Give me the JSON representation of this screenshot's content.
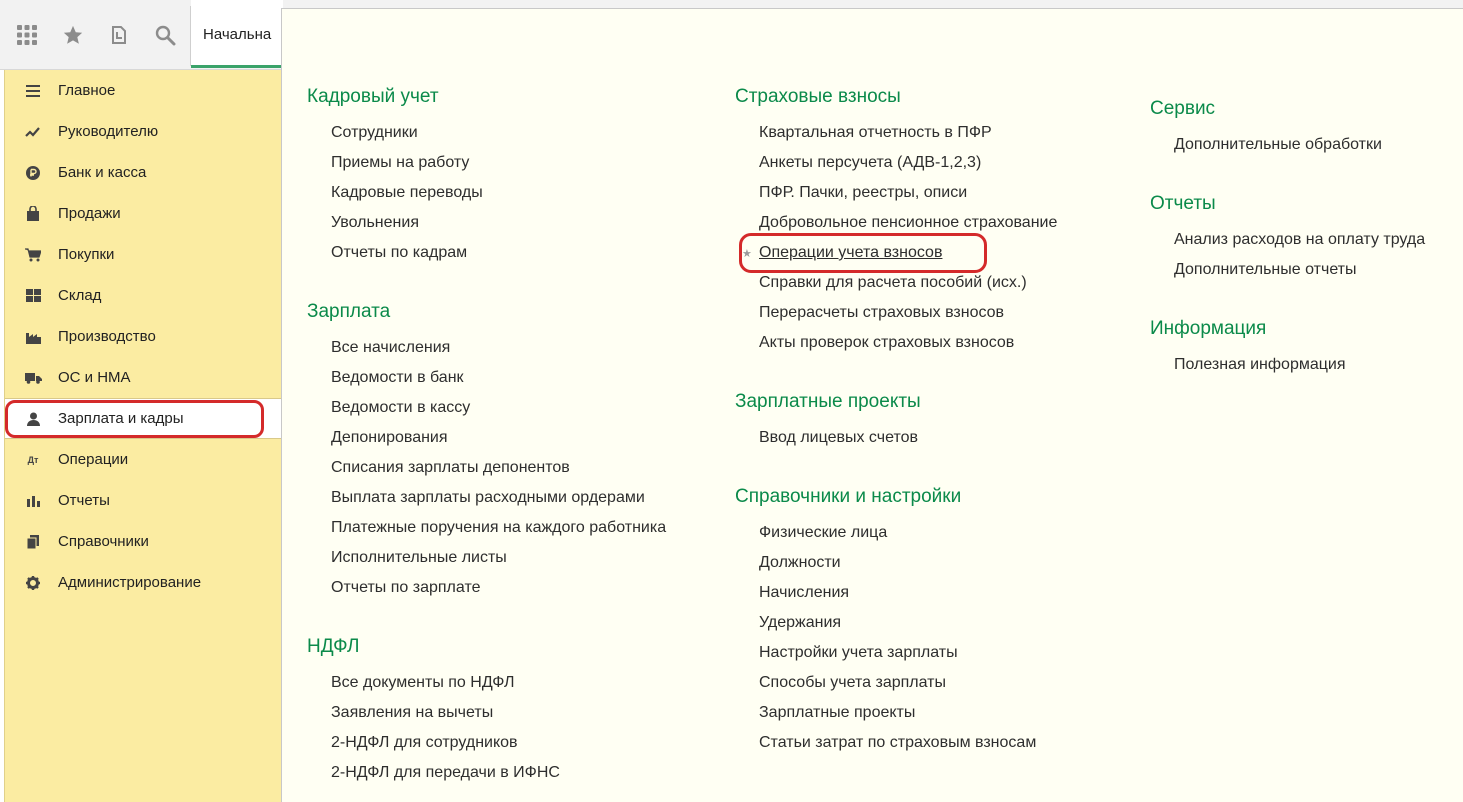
{
  "toolbar": {
    "icons": [
      "apps-grid-icon",
      "star-icon",
      "history-icon",
      "search-icon"
    ],
    "tab_label": "Начальна"
  },
  "sidebar": {
    "items": [
      {
        "label": "Главное",
        "icon": "menu-lines-icon"
      },
      {
        "label": "Руководителю",
        "icon": "trend-icon"
      },
      {
        "label": "Банк и касса",
        "icon": "ruble-coin-icon"
      },
      {
        "label": "Продажи",
        "icon": "shopping-bag-icon"
      },
      {
        "label": "Покупки",
        "icon": "cart-icon"
      },
      {
        "label": "Склад",
        "icon": "warehouse-icon"
      },
      {
        "label": "Производство",
        "icon": "factory-icon"
      },
      {
        "label": "ОС и НМА",
        "icon": "truck-icon"
      },
      {
        "label": "Зарплата и кадры",
        "icon": "person-icon"
      },
      {
        "label": "Операции",
        "icon": "debit-credit-icon"
      },
      {
        "label": "Отчеты",
        "icon": "bar-chart-icon"
      },
      {
        "label": "Справочники",
        "icon": "books-icon"
      },
      {
        "label": "Администрирование",
        "icon": "gear-icon"
      }
    ],
    "active_index": 8
  },
  "panel": {
    "col1": [
      {
        "title": "Кадровый учет",
        "links": [
          "Сотрудники",
          "Приемы на работу",
          "Кадровые переводы",
          "Увольнения",
          "Отчеты по кадрам"
        ]
      },
      {
        "title": "Зарплата",
        "links": [
          "Все начисления",
          "Ведомости в банк",
          "Ведомости в кассу",
          "Депонирования",
          "Списания зарплаты депонентов",
          "Выплата зарплаты расходными ордерами",
          "Платежные поручения на каждого работника",
          "Исполнительные листы",
          "Отчеты по зарплате"
        ]
      },
      {
        "title": "НДФЛ",
        "links": [
          "Все документы по НДФЛ",
          "Заявления на вычеты",
          "2-НДФЛ для сотрудников",
          "2-НДФЛ для передачи в ИФНС"
        ]
      }
    ],
    "col2": [
      {
        "title": "Страховые взносы",
        "links": [
          "Квартальная отчетность в ПФР",
          "Анкеты персучета (АДВ-1,2,3)",
          "ПФР. Пачки, реестры, описи",
          "Добровольное пенсионное страхование",
          "Операции учета взносов",
          "Справки для расчета пособий (исх.)",
          "Перерасчеты страховых взносов",
          "Акты проверок страховых взносов"
        ]
      },
      {
        "title": "Зарплатные проекты",
        "links": [
          "Ввод лицевых счетов"
        ]
      },
      {
        "title": "Справочники и настройки",
        "links": [
          "Физические лица",
          "Должности",
          "Начисления",
          "Удержания",
          "Настройки учета зарплаты",
          "Способы учета зарплаты",
          "Зарплатные проекты",
          "Статьи затрат по страховым взносам"
        ]
      }
    ],
    "col3": [
      {
        "title": "Сервис",
        "links": [
          "Дополнительные обработки"
        ]
      },
      {
        "title": "Отчеты",
        "links": [
          "Анализ расходов на оплату труда",
          "Дополнительные отчеты"
        ]
      },
      {
        "title": "Информация",
        "links": [
          "Полезная информация"
        ]
      }
    ],
    "highlighted_link": "Операции учета взносов",
    "favorite_marker": "★"
  }
}
